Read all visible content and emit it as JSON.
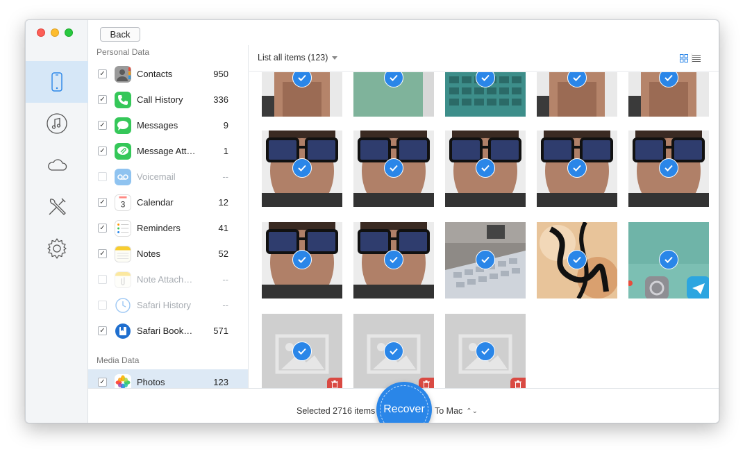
{
  "toolbar": {
    "back_label": "Back"
  },
  "rail": {
    "items": [
      {
        "icon": "iphone-icon",
        "active": true
      },
      {
        "icon": "music-icon",
        "active": false
      },
      {
        "icon": "cloud-icon",
        "active": false
      },
      {
        "icon": "tools-icon",
        "active": false
      },
      {
        "icon": "gear-icon",
        "active": false
      }
    ]
  },
  "categories": {
    "personal_title": "Personal Data",
    "media_title": "Media Data",
    "items": [
      {
        "label": "Contacts",
        "count": "950",
        "checked": "✓",
        "icon": "contacts-icon"
      },
      {
        "label": "Call History",
        "count": "336",
        "checked": "✓",
        "icon": "phone-icon"
      },
      {
        "label": "Messages",
        "count": "9",
        "checked": "✓",
        "icon": "messages-icon"
      },
      {
        "label": "Message Att…",
        "count": "1",
        "checked": "✓",
        "icon": "attachment-icon"
      },
      {
        "label": "Voicemail",
        "count": "--",
        "checked": "",
        "icon": "voicemail-icon"
      },
      {
        "label": "Calendar",
        "count": "12",
        "checked": "✓",
        "icon": "calendar-icon"
      },
      {
        "label": "Reminders",
        "count": "41",
        "checked": "✓",
        "icon": "reminders-icon"
      },
      {
        "label": "Notes",
        "count": "52",
        "checked": "✓",
        "icon": "notes-icon"
      },
      {
        "label": "Note Attach…",
        "count": "--",
        "checked": "",
        "icon": "note-attach-icon"
      },
      {
        "label": "Safari History",
        "count": "--",
        "checked": "",
        "icon": "safari-history-icon"
      },
      {
        "label": "Safari Book…",
        "count": "571",
        "checked": "✓",
        "icon": "safari-bookmark-icon"
      }
    ],
    "media_items": [
      {
        "label": "Photos",
        "count": "123",
        "checked": "✓",
        "icon": "photos-icon"
      }
    ],
    "calendar_day": "3"
  },
  "content": {
    "list_label": "List all items (123)"
  },
  "bottom": {
    "selected_text": "Selected 2716 items",
    "recover_label": "Recover",
    "destination": "To Mac",
    "destination_arrows": "⌃⌄"
  },
  "colors": {
    "accent": "#2a86e8",
    "delete": "#d94a43",
    "selected_row": "#dde9f5"
  }
}
